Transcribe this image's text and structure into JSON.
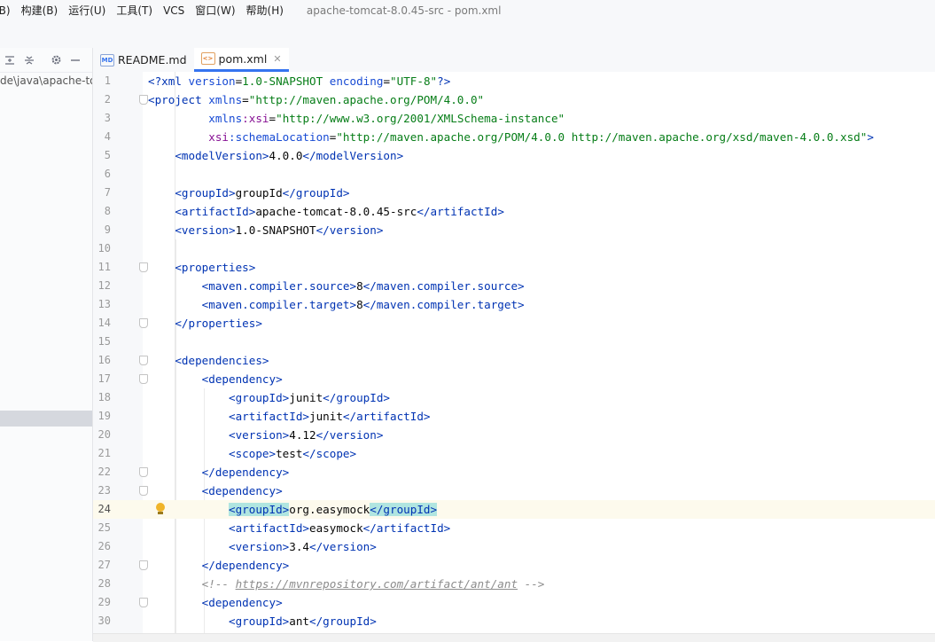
{
  "menu": {
    "items": [
      "(B)",
      "构建(B)",
      "运行(U)",
      "工具(T)",
      "VCS",
      "窗口(W)",
      "帮助(H)"
    ],
    "window_title": "apache-tomcat-8.0.45-src - pom.xml"
  },
  "sidebar": {
    "path_text": "de\\java\\apache-to",
    "icons": [
      "expand-all-icon",
      "collapse-all-icon",
      "gear-icon",
      "minimize-icon"
    ]
  },
  "tabs": [
    {
      "label": "README.md",
      "icon": "MD",
      "active": false
    },
    {
      "label": "pom.xml",
      "icon": "<>",
      "active": true
    }
  ],
  "editor": {
    "current_line": 24,
    "lines": [
      {
        "n": "1"
      },
      {
        "n": "2"
      },
      {
        "n": "3"
      },
      {
        "n": "4"
      },
      {
        "n": "5"
      },
      {
        "n": "6"
      },
      {
        "n": "7"
      },
      {
        "n": "8"
      },
      {
        "n": "9"
      },
      {
        "n": "10"
      },
      {
        "n": "11"
      },
      {
        "n": "12"
      },
      {
        "n": "13"
      },
      {
        "n": "14"
      },
      {
        "n": "15"
      },
      {
        "n": "16"
      },
      {
        "n": "17"
      },
      {
        "n": "18"
      },
      {
        "n": "19"
      },
      {
        "n": "20"
      },
      {
        "n": "21"
      },
      {
        "n": "22"
      },
      {
        "n": "23"
      },
      {
        "n": "24"
      },
      {
        "n": "25"
      },
      {
        "n": "26"
      },
      {
        "n": "27"
      },
      {
        "n": "28"
      },
      {
        "n": "29"
      },
      {
        "n": "30"
      }
    ],
    "xml": {
      "version": "1.0-SNAPSHOT",
      "encoding": "\"UTF-8\"",
      "pom_ns": "\"http://maven.apache.org/POM/4.0.0\"",
      "xsi_ns": "\"http://www.w3.org/2001/XMLSchema-instance\"",
      "schema_loc": "\"http://maven.apache.org/POM/4.0.0 http://maven.apache.org/xsd/maven-4.0.0.xsd\"",
      "model_version": "4.0.0",
      "group_id": "groupId",
      "artifact_id": "apache-tomcat-8.0.45-src",
      "source": "8",
      "target": "8",
      "dep1": {
        "group": "junit",
        "artifact": "junit",
        "version": "4.12",
        "scope": "test"
      },
      "dep2": {
        "group": "org.easymock",
        "artifact": "easymock",
        "version": "3.4"
      },
      "comment_url": "https://mvnrepository.com/artifact/ant/ant",
      "dep3": {
        "group": "ant"
      }
    }
  },
  "colors": {
    "tag": "#0033b3",
    "attr": "#174ad4",
    "value": "#067d17",
    "namespace": "#871094",
    "accent": "#3574f0"
  }
}
